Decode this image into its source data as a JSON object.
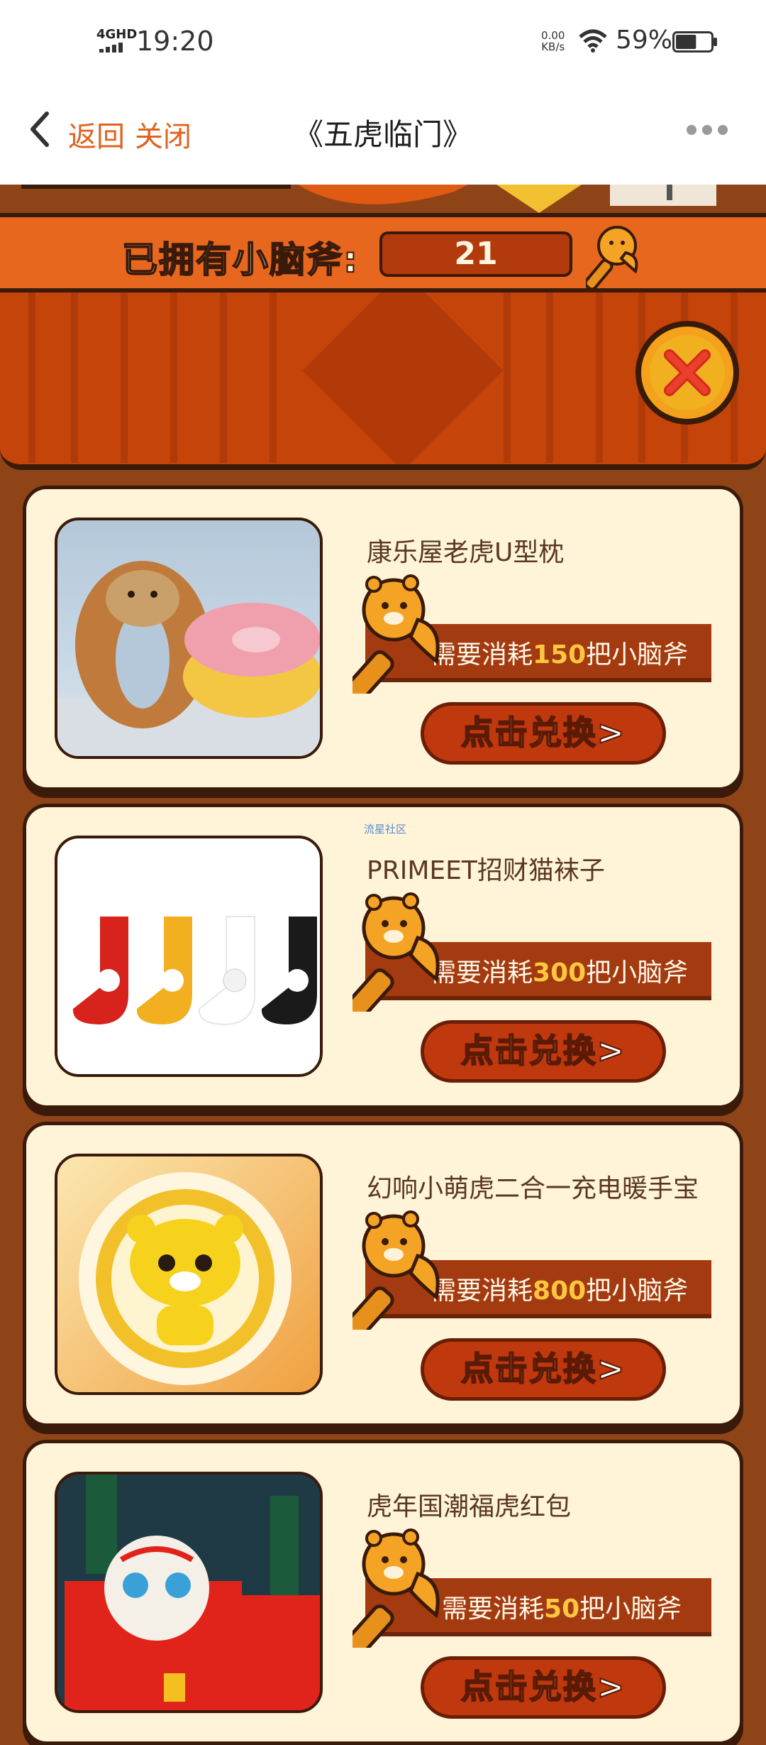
{
  "status_bar": {
    "network": "4GHD",
    "time": "19:20",
    "speed_value": "0.00",
    "speed_unit": "KB/s",
    "battery_percent": "59%",
    "battery_level": 0.59
  },
  "nav": {
    "back_label": "返回",
    "close_label": "关闭",
    "title": "《五虎临门》"
  },
  "counter": {
    "label": "已拥有小脑斧:",
    "value": "21"
  },
  "watermark": "流星社区",
  "cards": [
    {
      "name": "康乐屋老虎U型枕",
      "cost_prefix": "需要消耗",
      "cost": "150",
      "cost_suffix": "把小脑斧",
      "button": "点击兑换>"
    },
    {
      "name": "PRIMEET招财猫袜子",
      "cost_prefix": "需要消耗",
      "cost": "300",
      "cost_suffix": "把小脑斧",
      "button": "点击兑换>"
    },
    {
      "name": "幻响小萌虎二合一充电暖手宝",
      "cost_prefix": "需要消耗",
      "cost": "800",
      "cost_suffix": "把小脑斧",
      "button": "点击兑换>"
    },
    {
      "name": "虎年国潮福虎红包",
      "cost_prefix": "需要消耗",
      "cost": "50",
      "cost_suffix": "把小脑斧",
      "button": "点击兑换>"
    }
  ],
  "icons": {
    "back": "chevron-left-icon",
    "more": "more-dots-icon",
    "axe": "tiger-axe-icon",
    "close": "close-icon",
    "wifi": "wifi-icon",
    "battery": "battery-icon",
    "signal": "signal-icon"
  }
}
